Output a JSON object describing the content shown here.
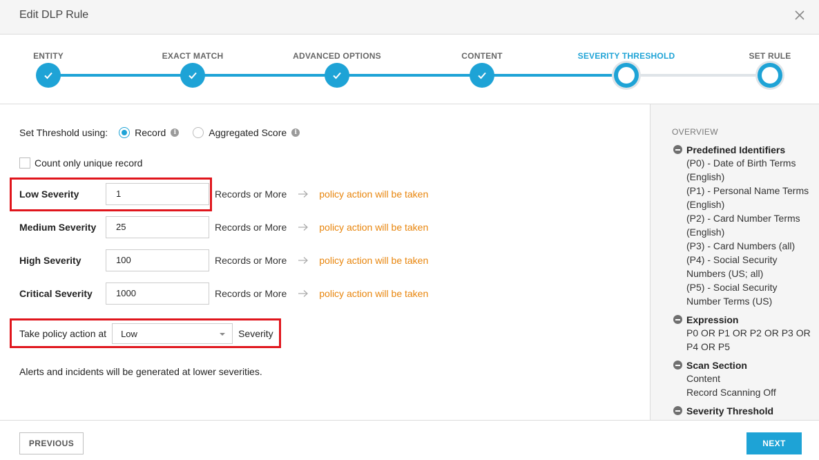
{
  "dialog": {
    "title": "Edit DLP Rule"
  },
  "stepper": {
    "steps": [
      {
        "label": "ENTITY",
        "state": "done"
      },
      {
        "label": "EXACT MATCH",
        "state": "done"
      },
      {
        "label": "ADVANCED OPTIONS",
        "state": "done"
      },
      {
        "label": "CONTENT",
        "state": "done"
      },
      {
        "label": "SEVERITY THRESHOLD",
        "state": "current"
      },
      {
        "label": "SET RULE",
        "state": "todo"
      }
    ]
  },
  "threshold": {
    "label": "Set Threshold using:",
    "option_record": "Record",
    "option_aggregated": "Aggregated Score",
    "selected": "Record"
  },
  "unique": {
    "label": "Count only unique record",
    "checked": false
  },
  "severities": [
    {
      "name": "Low Severity",
      "value": "1",
      "suffix": "Records or More",
      "action": "policy action will be taken"
    },
    {
      "name": "Medium Severity",
      "value": "25",
      "suffix": "Records or More",
      "action": "policy action will be taken"
    },
    {
      "name": "High Severity",
      "value": "100",
      "suffix": "Records or More",
      "action": "policy action will be taken"
    },
    {
      "name": "Critical Severity",
      "value": "1000",
      "suffix": "Records or More",
      "action": "policy action will be taken"
    }
  ],
  "policy": {
    "prefix": "Take policy action at",
    "selected": "Low",
    "suffix": "Severity"
  },
  "note": "Alerts and incidents will be generated at lower severities.",
  "overview": {
    "title": "OVERVIEW",
    "sections": [
      {
        "heading": "Predefined Identifiers",
        "items": [
          "(P0) - Date of Birth Terms (English)",
          "(P1) - Personal Name Terms (English)",
          "(P2) - Card Number Terms (English)",
          "(P3) - Card Numbers (all)",
          "(P4) - Social Security Numbers (US; all)",
          "(P5) - Social Security Number Terms (US)"
        ]
      },
      {
        "heading": "Expression",
        "items": [
          "P0 OR P1 OR P2 OR P3 OR P4 OR P5"
        ]
      },
      {
        "heading": "Scan Section",
        "items": [
          "Content",
          "Record Scanning Off"
        ]
      },
      {
        "heading": "Severity Threshold",
        "items": []
      }
    ]
  },
  "footer": {
    "previous": "PREVIOUS",
    "next": "NEXT"
  },
  "colors": {
    "accent": "#1ea3d6",
    "action": "#e8850c",
    "highlight": "#e0151c"
  }
}
